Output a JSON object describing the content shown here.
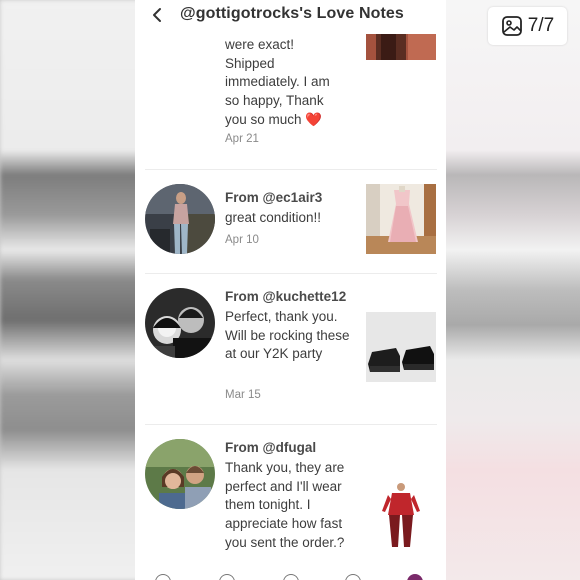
{
  "header": {
    "back_icon": "chevron-left-icon",
    "title": "@gottigotrocks's Love Notes"
  },
  "gallery_badge": {
    "icon": "image-gallery-icon",
    "counter": "7/7"
  },
  "notes": [
    {
      "from": "",
      "text": "were exact! Shipped immediately. I am so happy, Thank you so much",
      "emoji": "❤️",
      "date": "Apr 21"
    },
    {
      "from": "From @ec1air3",
      "text": "great condition!!",
      "date": "Apr 10"
    },
    {
      "from": "From @kuchette12",
      "text": "Perfect, thank you. Will be rocking these at our Y2K party",
      "date": "Mar 15"
    },
    {
      "from": "From @dfugal",
      "text": "Thank you, they are perfect and I'll wear them tonight. I appreciate how fast you sent the order.?",
      "date": ""
    }
  ],
  "colors": {
    "heart": "#e8264a",
    "text": "#3d3d3d",
    "date": "#8a8a8a"
  }
}
